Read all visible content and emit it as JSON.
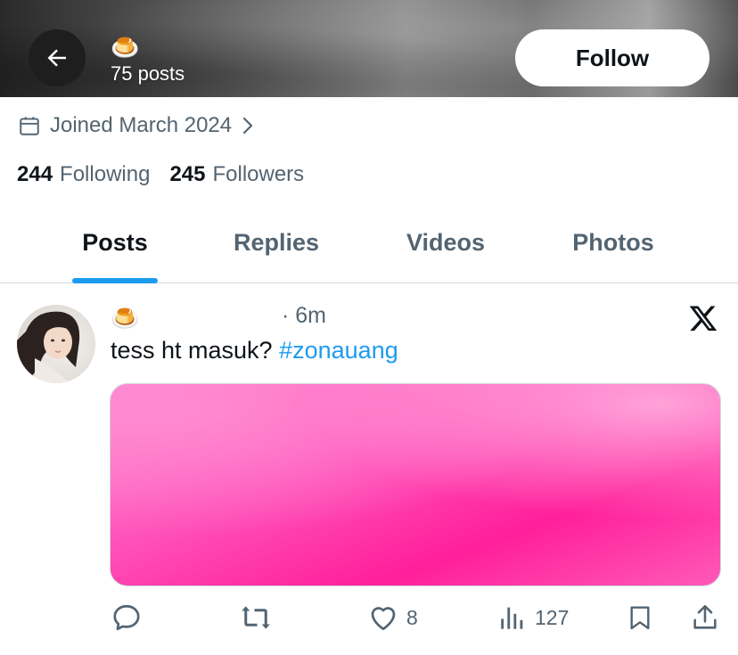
{
  "header": {
    "avatar_emoji": "🍮",
    "posts_count": "75 posts",
    "follow_label": "Follow",
    "back_icon": "arrow-left-icon"
  },
  "profile": {
    "joined": "Joined March 2024",
    "following_count": "244",
    "following_label": "Following",
    "followers_count": "245",
    "followers_label": "Followers"
  },
  "tabs": [
    {
      "label": "Posts",
      "active": true
    },
    {
      "label": "Replies",
      "active": false
    },
    {
      "label": "Videos",
      "active": false
    },
    {
      "label": "Photos",
      "active": false
    }
  ],
  "post": {
    "author_emoji": "🍮",
    "time": "6m",
    "text": "tess ht masuk? ",
    "hashtag": "#zonauang",
    "actions": {
      "reply_icon": "reply-icon",
      "repost_icon": "repost-icon",
      "like_icon": "heart-icon",
      "like_count": "8",
      "views_icon": "views-icon",
      "views_count": "127",
      "bookmark_icon": "bookmark-icon",
      "share_icon": "share-icon"
    }
  },
  "colors": {
    "accent": "#1d9bf0",
    "secondary_text": "#536471",
    "media_pink": "#ff2e9f"
  }
}
